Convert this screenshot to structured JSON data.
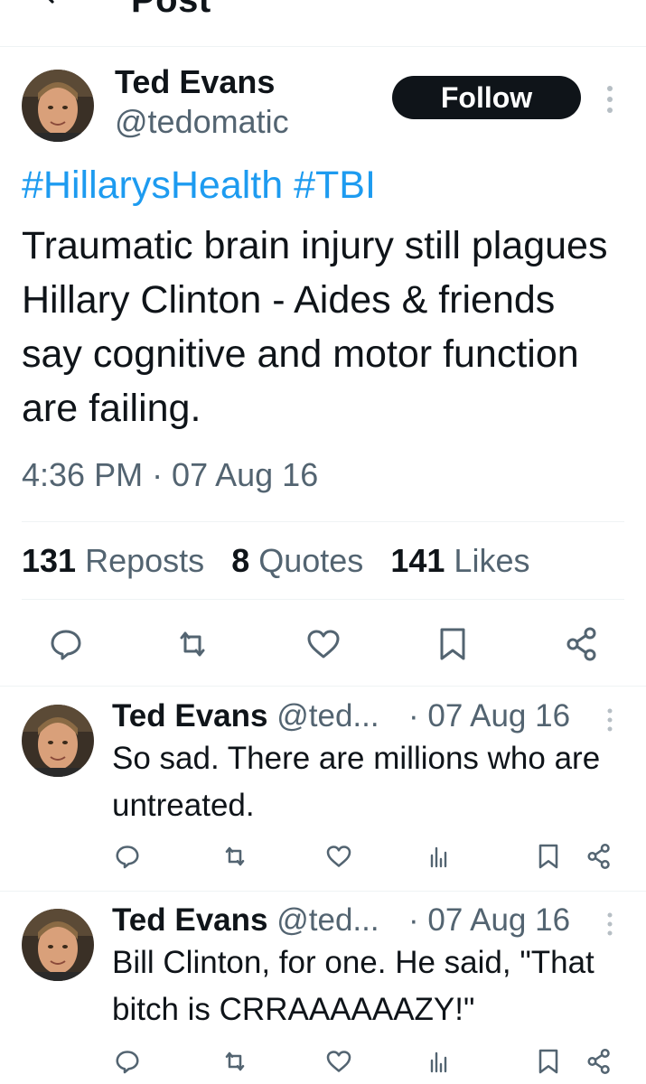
{
  "header": {
    "title": "Post",
    "back_icon": "back-arrow-icon"
  },
  "post": {
    "author_name": "Ted Evans",
    "author_handle": "@tedomatic",
    "follow_label": "Follow",
    "hashtag_1": "#HillarysHealth",
    "hashtag_2": "#TBI",
    "text": "Traumatic brain injury still plagues Hillary Clinton - Aides & friends say cognitive and motor function are failing.",
    "timestamp": "4:36 PM · 07 Aug 16",
    "stats": {
      "reposts_count": "131",
      "reposts_label": "Reposts",
      "quotes_count": "8",
      "quotes_label": "Quotes",
      "likes_count": "141",
      "likes_label": "Likes"
    },
    "actions": [
      "reply-icon",
      "repost-icon",
      "like-icon",
      "bookmark-icon",
      "share-icon"
    ]
  },
  "replies": [
    {
      "author_name": "Ted Evans",
      "author_handle": "@ted...",
      "date": "· 07 Aug 16",
      "text": "So sad. There are millions who are untreated."
    },
    {
      "author_name": "Ted Evans",
      "author_handle": "@ted...",
      "date": "· 07 Aug 16",
      "text": "Bill Clinton, for one. He said, \"That bitch is CRRAAAAAAZY!\""
    }
  ],
  "colors": {
    "accent": "#1d9bf0",
    "text": "#0f1419",
    "muted": "#536471",
    "divider": "#eff3f4"
  }
}
